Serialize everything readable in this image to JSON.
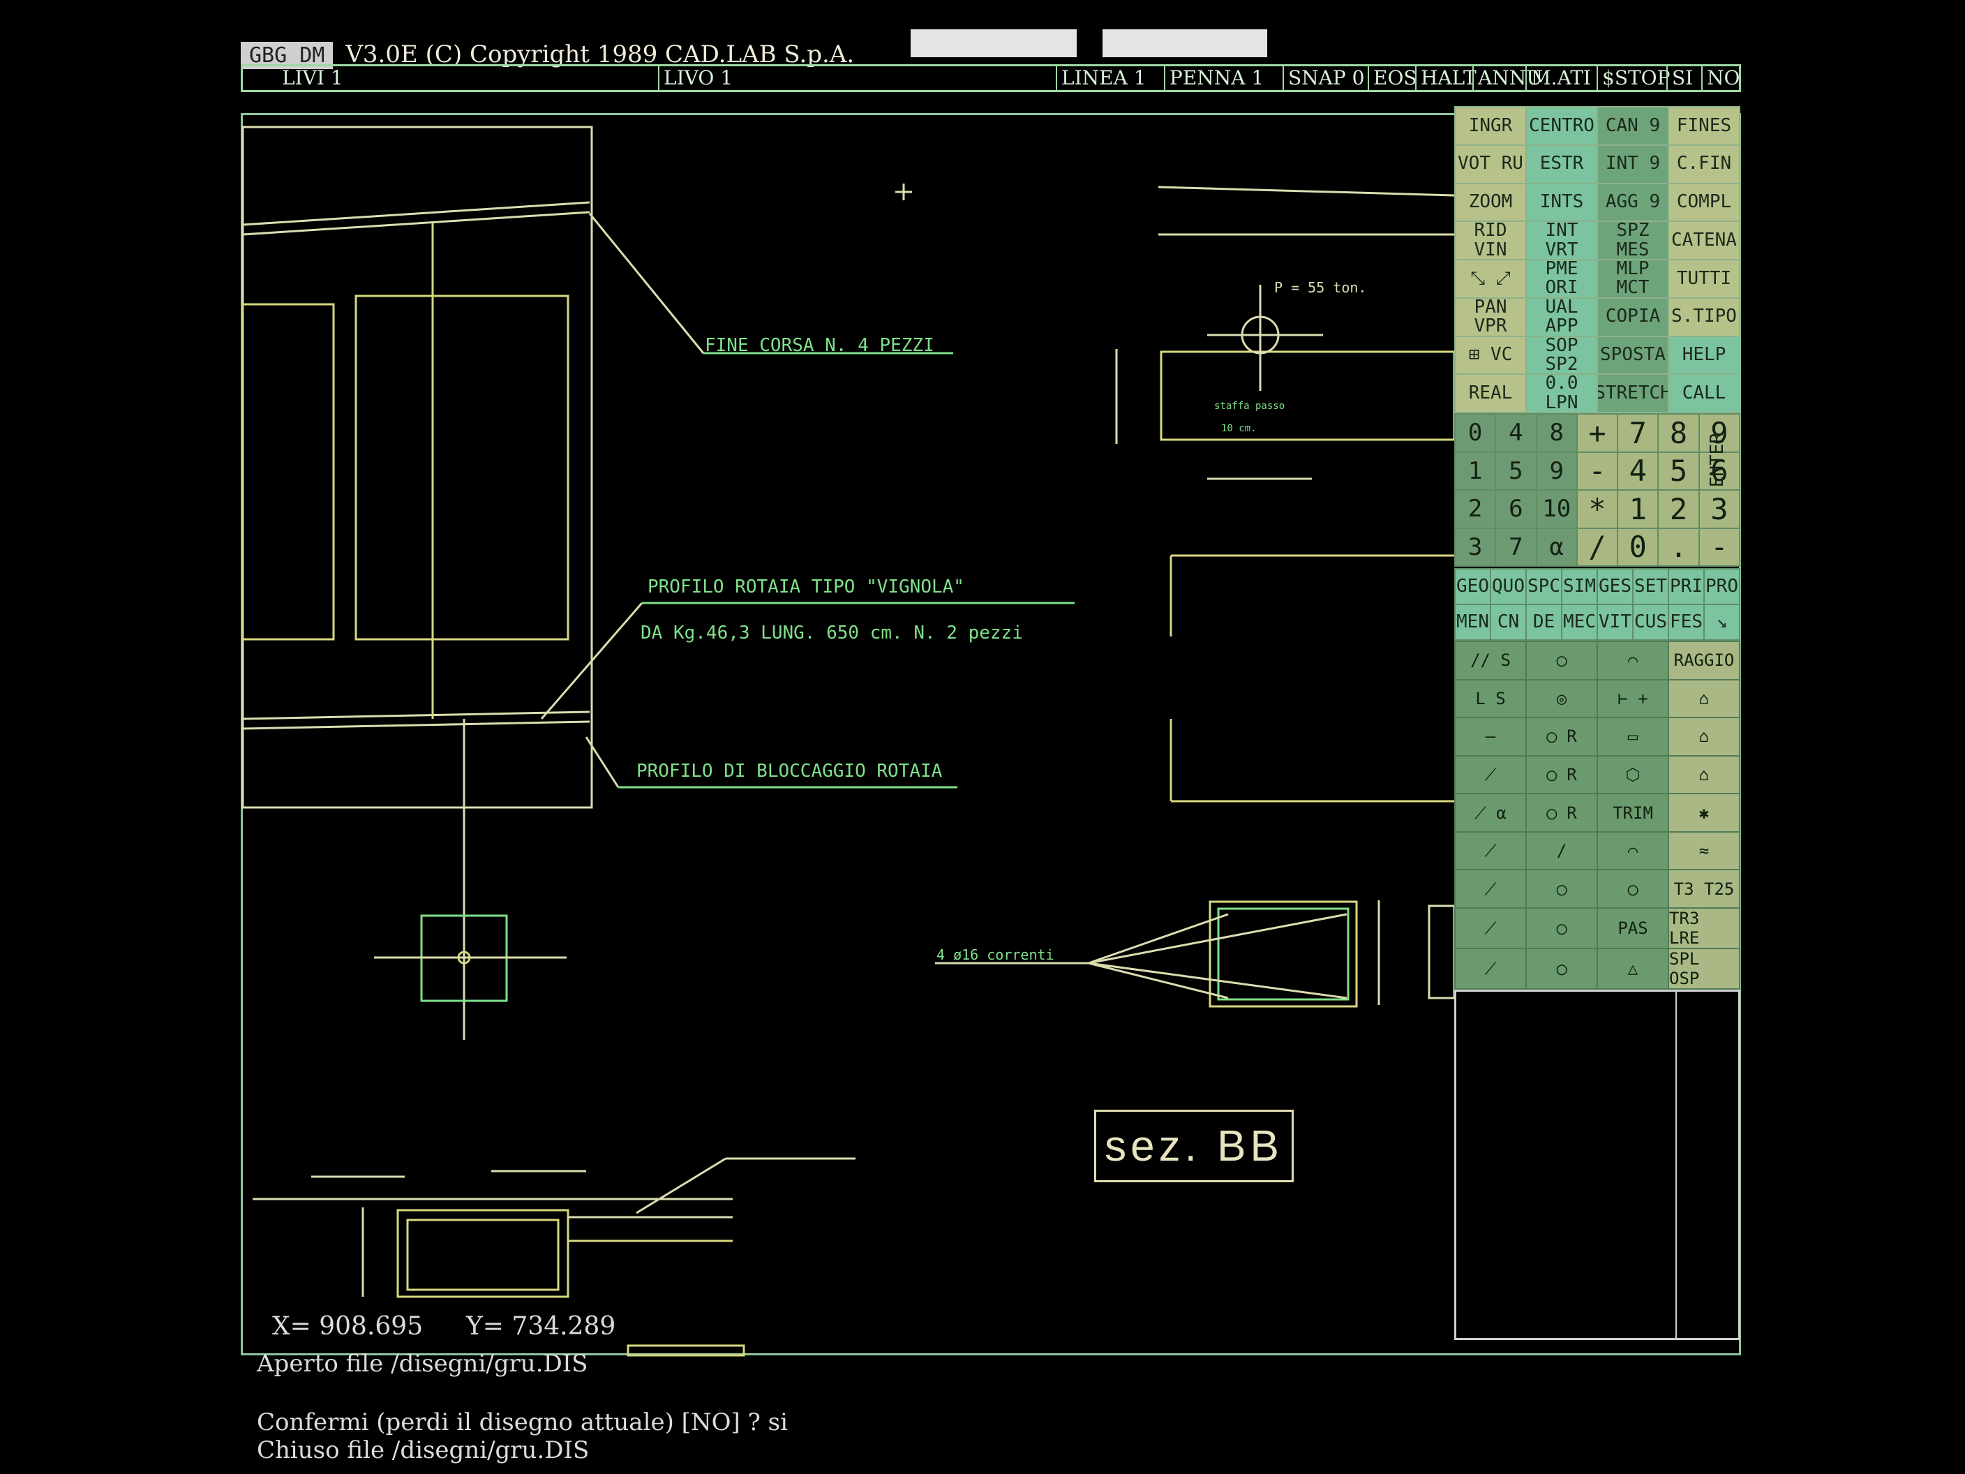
{
  "header": {
    "program": "GBG DM",
    "version": "V3.0E (C) Copyright 1989 CAD.LAB S.p.A."
  },
  "statusbar": {
    "livi_label": "LIVI",
    "livi_value": "1",
    "livo_label": "LIVO",
    "livo_value": "1",
    "linea_label": "LINEA",
    "linea_value": "1",
    "penna_label": "PENNA",
    "penna_value": "1",
    "snap_label": "SNAP",
    "snap_value": "0",
    "eos": "EOS",
    "halt": "HALT",
    "annu": "ANNU",
    "mati": "M.ATI",
    "stop": "$STOP",
    "si": "SI",
    "no": "NO"
  },
  "menu_cells": [
    "INGR",
    "CENTRO",
    "CAN 9",
    "FINES",
    "VOT RU",
    "ESTR",
    "INT 9",
    "C.FIN",
    "ZOOM",
    "INTS",
    "AGG 9",
    "COMPL",
    "RID VIN",
    "INT VRT",
    "SPZ MES",
    "CATENA",
    "⤡ ⤢",
    "PME ORI",
    "MLP MCT",
    "TUTTI",
    "PAN VPR",
    "UAL APP",
    "COPIA",
    "S.TIPO",
    "⊞ VC",
    "SOP SP2",
    "SPOSTA",
    "HELP",
    "REAL",
    "0.0 LPN",
    "STRETCH",
    "CALL"
  ],
  "numpad": [
    "0",
    "4",
    "8",
    "+",
    "7",
    "8",
    "9",
    "1",
    "5",
    "9",
    "-",
    "4",
    "5",
    "6",
    "2",
    "6",
    "10",
    "*",
    "1",
    "2",
    "3",
    "3",
    "7",
    "α",
    "/",
    "0",
    ".",
    "-"
  ],
  "enter_label": "ENTER",
  "func_row1": [
    "GEO",
    "QUO",
    "SPC",
    "SIM",
    "GES",
    "SET",
    "PRI",
    "PRO"
  ],
  "func_row2": [
    "MEN",
    "CN",
    "DE",
    "MEC",
    "VIT",
    "CUS",
    "FES",
    "↘"
  ],
  "shape_cells": [
    "∕∕ S",
    "◯",
    "⌒",
    "RAGGIO",
    "L S",
    "◎",
    "⊢ +",
    "⌂",
    "—",
    "◯ R",
    "▭",
    "⌂",
    "⟋",
    "◯ R",
    "⬡",
    "⌂",
    "⟋ α",
    "◯ R",
    "TRIM",
    "✱",
    "⟋",
    "∕",
    "⌒",
    "≈",
    "⟋",
    "◯",
    "◯",
    "T3 T25",
    "⟋",
    "◯",
    "PAS",
    "TR3 LRE",
    "⟋",
    "◯",
    "△",
    "SPL OSP"
  ],
  "annotations": {
    "fine_corsa": "FINE CORSA N. 4 PEZZI",
    "profilo_rotaia": "PROFILO ROTAIA TIPO \"VIGNOLA\"",
    "da_kg": "DA Kg.46,3  LUNG. 650 cm. N. 2 pezzi",
    "profilo_bloccaggio": "PROFILO DI BLOCCAGGIO ROTAIA",
    "load": "P = 55 ton.",
    "staffe": "staffa passo",
    "staffe2": "10 cm.",
    "correnti": "4 ø16 correnti",
    "section": "sez. BB"
  },
  "coords": {
    "x_label": "X=",
    "x": "908.695",
    "y_label": "Y=",
    "y": "734.289"
  },
  "console": {
    "line1": "Aperto file /disegni/gru.DIS",
    "line2": "Confermi (perdi il disegno attuale) [NO] ? si",
    "line3": "Chiuso file /disegni/gru.DIS"
  }
}
